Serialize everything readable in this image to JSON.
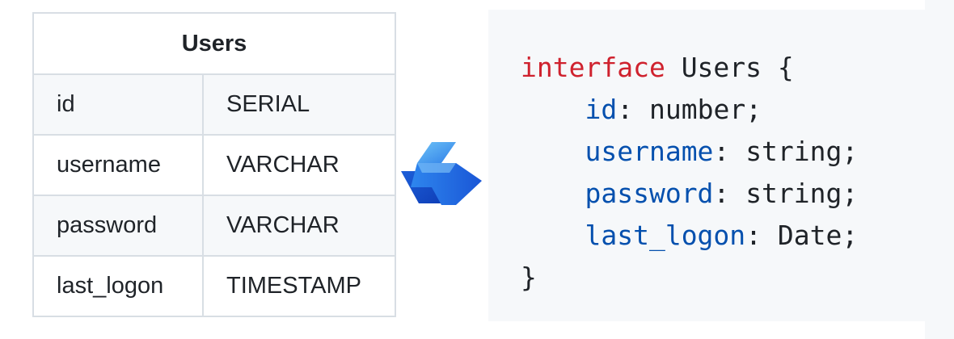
{
  "table": {
    "title": "Users",
    "rows": [
      {
        "name": "id",
        "type": "SERIAL"
      },
      {
        "name": "username",
        "type": "VARCHAR"
      },
      {
        "name": "password",
        "type": "VARCHAR"
      },
      {
        "name": "last_logon",
        "type": "TIMESTAMP"
      }
    ]
  },
  "arrow": {
    "icon": "right-arrow-icon",
    "color_light": "#5fb8f5",
    "color_dark": "#1a56d6"
  },
  "code": {
    "keyword": "interface",
    "name": "Users",
    "open_brace": "{",
    "close_brace": "}",
    "fields": [
      {
        "prop": "id",
        "type": "number"
      },
      {
        "prop": "username",
        "type": "string"
      },
      {
        "prop": "password",
        "type": "string"
      },
      {
        "prop": "last_logon",
        "type": "Date"
      }
    ],
    "keyword_color": "#cf222e",
    "property_color": "#0550ae"
  }
}
